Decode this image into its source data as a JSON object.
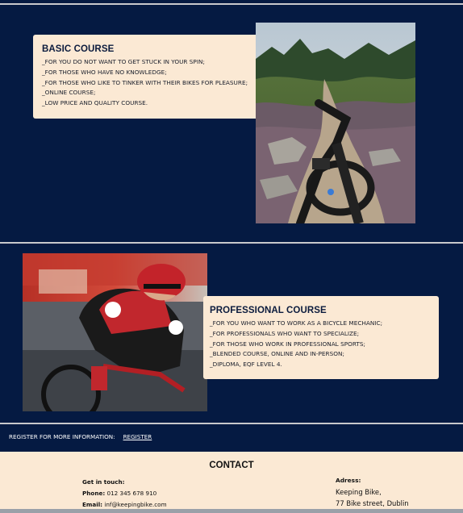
{
  "basic_course": {
    "title": "BASIC COURSE",
    "items": [
      "_FOR YOU DO NOT WANT TO GET STUCK IN YOUR SPIN;",
      "_FOR THOSE WHO HAVE NO KNOWLEDGE;",
      "_FOR THOSE WHO LIKE TO TINKER WITH THEIR BIKES FOR PLEASURE;",
      "_ONLINE COURSE;",
      "_LOW PRICE AND QUALITY COURSE."
    ]
  },
  "professional_course": {
    "title": "PROFESSIONAL COURSE",
    "items": [
      "_FOR YOU WHO WANT TO WORK AS A BICYCLE MECHANIC;",
      "_FOR PROFESSIONALS WHO WANT TO SPECIALIZE;",
      "_FOR THOSE WHO WORK IN PROFESSIONAL SPORTS;",
      "_BLENDED COURSE, ONLINE AND IN-PERSON;",
      "_DIPLOMA, EQF LEVEL 4."
    ]
  },
  "register": {
    "label": "REGISTER FOR MORE INFORMATION:",
    "link": "REGISTER"
  },
  "contact": {
    "title": "CONTACT",
    "get_in_touch": "Get in touch:",
    "phone_label": "Phone:",
    "phone": "012 345 678 910",
    "email_label": "Email:",
    "email": "inf@keepingbike.com",
    "address_label": "Adress:",
    "address_line1": "Keeping Bike,",
    "address_line2": "77 Bike street, Dublin"
  },
  "colors": {
    "background": "#051a42",
    "card": "#fbe9d4",
    "text_dark": "#0b1b3d"
  },
  "images": {
    "basic_photo": "mountain-bike-trail-photo",
    "professional_photo": "road-cyclist-racing-photo"
  }
}
